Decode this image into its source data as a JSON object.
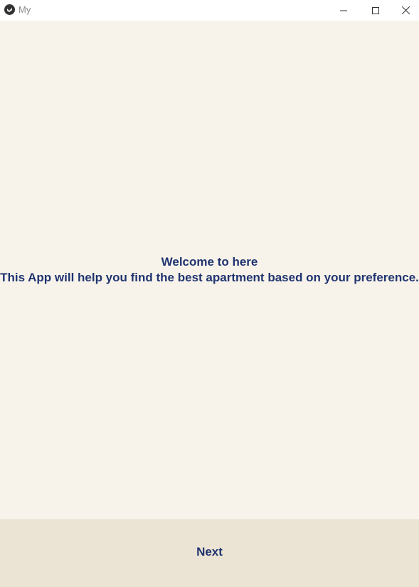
{
  "window": {
    "title": "My",
    "icon": "kivy-app-icon",
    "controls": {
      "minimize_icon": "minimize-icon",
      "maximize_icon": "maximize-icon",
      "close_icon": "close-icon"
    }
  },
  "main": {
    "welcome_line1": "Welcome to here",
    "welcome_line2": "This App will help you find the best apartment based on your preference."
  },
  "footer": {
    "next_label": "Next"
  },
  "colors": {
    "background": "#f8f3ea",
    "footer_background": "#ebe3d3",
    "text": "#1f3470",
    "titlebar": "#ffffff"
  }
}
